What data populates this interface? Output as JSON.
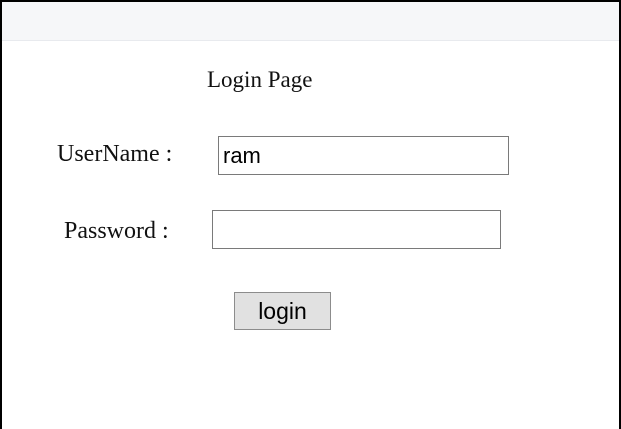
{
  "page": {
    "title": "Login Page"
  },
  "form": {
    "username_label": "UserName :",
    "username_value": "ram",
    "password_label": "Password :",
    "password_value": "",
    "login_label": "login"
  },
  "colors": {
    "background": "#ffffff",
    "topbar": "#f6f7f9",
    "button_bg": "#e1e1e1",
    "border": "#000000"
  }
}
